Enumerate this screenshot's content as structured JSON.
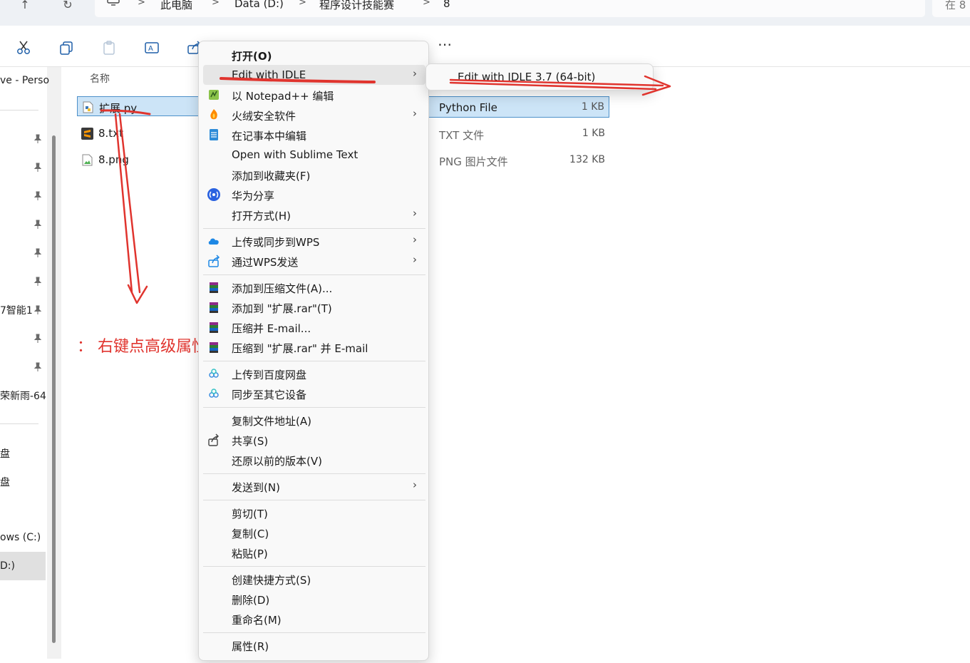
{
  "addressbar": {
    "up_icon": "up-arrow-icon",
    "refresh_icon": "refresh-icon",
    "computer_icon": "computer-icon",
    "crumbs": [
      "此电脑",
      "Data (D:)",
      "程序设计技能赛",
      "8"
    ],
    "search_placeholder": "在 8"
  },
  "toolbar": {
    "icons": [
      "cut-icon",
      "copy-icon",
      "paste-icon",
      "rename-icon",
      "share-icon"
    ],
    "more_label": "⋯"
  },
  "sidebar": {
    "items": [
      "ve - Perso",
      "7智能1",
      "荣新雨-64",
      "盘",
      "盘",
      "ows (C:)",
      "D:)"
    ]
  },
  "filelist": {
    "column_name": "名称",
    "files": [
      {
        "name": "扩展.py",
        "type": "Python File",
        "size": "1 KB",
        "icon": "python-file-icon"
      },
      {
        "name": "8.txt",
        "type": "TXT 文件",
        "size": "1 KB",
        "icon": "sublime-text-icon"
      },
      {
        "name": "8.png",
        "type": "PNG 图片文件",
        "size": "132 KB",
        "icon": "image-file-icon"
      }
    ]
  },
  "annotation": {
    "text": "： 右键点高级属性"
  },
  "context_menu": {
    "items": [
      {
        "label": "打开(O)",
        "icon": "",
        "arrow": false
      },
      {
        "label": "Edit with IDLE",
        "icon": "",
        "arrow": true
      },
      {
        "label": "以 Notepad++ 编辑",
        "icon": "notepadpp-icon",
        "arrow": false
      },
      {
        "label": "火绒安全软件",
        "icon": "huorong-icon",
        "arrow": true
      },
      {
        "label": "在记事本中编辑",
        "icon": "notepad-icon",
        "arrow": false
      },
      {
        "label": "Open with Sublime Text",
        "icon": "",
        "arrow": false
      },
      {
        "label": "添加到收藏夹(F)",
        "icon": "",
        "arrow": false
      },
      {
        "label": "华为分享",
        "icon": "huawei-share-icon",
        "arrow": false
      },
      {
        "label": "打开方式(H)",
        "icon": "",
        "arrow": true
      },
      {
        "label": "上传或同步到WPS",
        "icon": "wps-cloud-icon",
        "arrow": true
      },
      {
        "label": "通过WPS发送",
        "icon": "wps-send-icon",
        "arrow": true
      },
      {
        "label": "添加到压缩文件(A)...",
        "icon": "winrar-icon",
        "arrow": false
      },
      {
        "label": "添加到 \"扩展.rar\"(T)",
        "icon": "winrar-icon",
        "arrow": false
      },
      {
        "label": "压缩并 E-mail...",
        "icon": "winrar-icon",
        "arrow": false
      },
      {
        "label": "压缩到 \"扩展.rar\" 并 E-mail",
        "icon": "winrar-icon",
        "arrow": false
      },
      {
        "label": "上传到百度网盘",
        "icon": "baidu-netdisk-icon",
        "arrow": false
      },
      {
        "label": "同步至其它设备",
        "icon": "baidu-netdisk-icon",
        "arrow": false
      },
      {
        "label": "复制文件地址(A)",
        "icon": "",
        "arrow": false
      },
      {
        "label": "共享(S)",
        "icon": "share-icon",
        "arrow": false
      },
      {
        "label": "还原以前的版本(V)",
        "icon": "",
        "arrow": false
      },
      {
        "label": "发送到(N)",
        "icon": "",
        "arrow": true
      },
      {
        "label": "剪切(T)",
        "icon": "",
        "arrow": false
      },
      {
        "label": "复制(C)",
        "icon": "",
        "arrow": false
      },
      {
        "label": "粘贴(P)",
        "icon": "",
        "arrow": false
      },
      {
        "label": "创建快捷方式(S)",
        "icon": "",
        "arrow": false
      },
      {
        "label": "删除(D)",
        "icon": "",
        "arrow": false
      },
      {
        "label": "重命名(M)",
        "icon": "",
        "arrow": false
      },
      {
        "label": "属性(R)",
        "icon": "",
        "arrow": false
      }
    ],
    "submenu_label": "Edit with IDLE 3.7 (64-bit)"
  },
  "colors": {
    "selection_bg": "#cce4f7",
    "selection_border": "#4d90c9",
    "annotation_red": "#e0342e"
  }
}
